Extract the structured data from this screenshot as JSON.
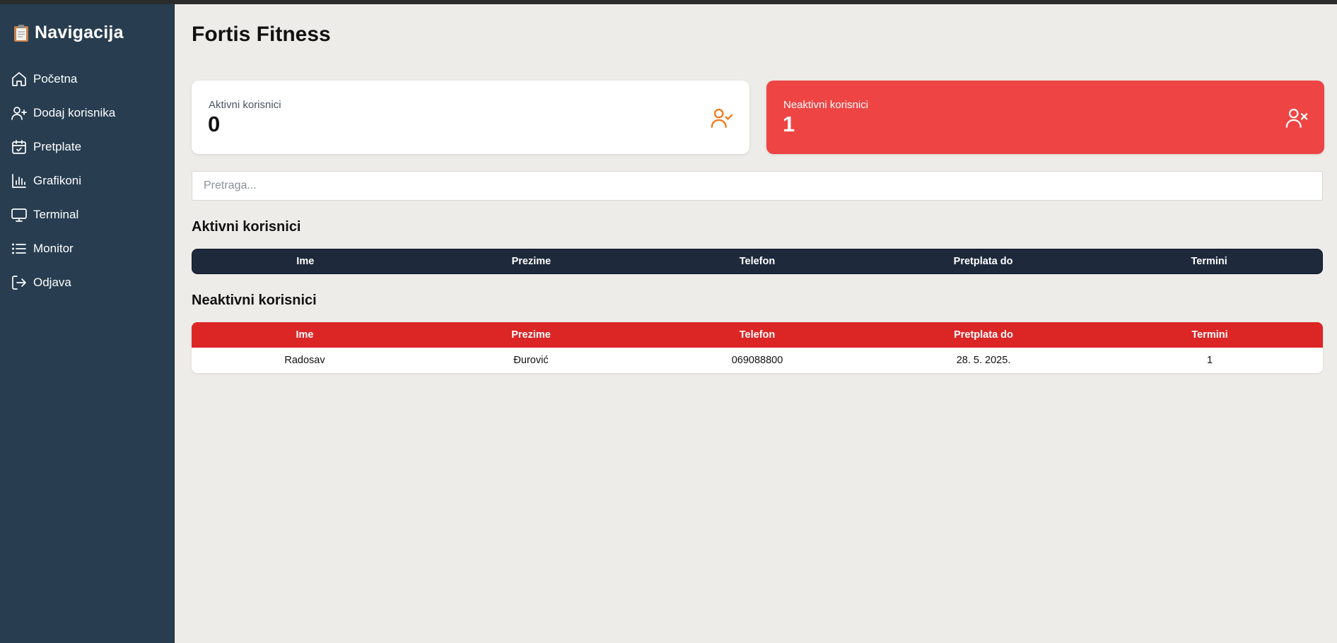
{
  "sidebar": {
    "brand_icon": "clipboard-icon",
    "title": "Navigacija",
    "items": [
      {
        "label": "Početna",
        "icon": "home-icon"
      },
      {
        "label": "Dodaj korisnika",
        "icon": "user-plus-icon"
      },
      {
        "label": "Pretplate",
        "icon": "calendar-check-icon"
      },
      {
        "label": "Grafikoni",
        "icon": "bar-chart-icon"
      },
      {
        "label": "Terminal",
        "icon": "monitor-icon"
      },
      {
        "label": "Monitor",
        "icon": "list-icon"
      },
      {
        "label": "Odjava",
        "icon": "logout-icon"
      }
    ]
  },
  "main": {
    "title": "Fortis Fitness",
    "cards": {
      "active": {
        "label": "Aktivni korisnici",
        "value": "0",
        "icon": "user-check-icon",
        "color": "#f97316"
      },
      "inactive": {
        "label": "Neaktivni korisnici",
        "value": "1",
        "icon": "user-x-icon",
        "color": "#ef4444"
      }
    },
    "search": {
      "placeholder": "Pretraga...",
      "value": ""
    },
    "active_section": {
      "title": "Aktivni korisnici",
      "columns": [
        "Ime",
        "Prezime",
        "Telefon",
        "Pretplata do",
        "Termini"
      ],
      "rows": []
    },
    "inactive_section": {
      "title": "Neaktivni korisnici",
      "columns": [
        "Ime",
        "Prezime",
        "Telefon",
        "Pretplata do",
        "Termini"
      ],
      "rows": [
        [
          "Radosav",
          "Đurović",
          "069088800",
          "28. 5. 2025.",
          "1"
        ]
      ]
    }
  },
  "colors": {
    "sidebar_bg": "#283d50",
    "active_header": "#1e293b",
    "inactive_header": "#dc2626",
    "inactive_card": "#ef4444",
    "accent_orange": "#f97316"
  }
}
